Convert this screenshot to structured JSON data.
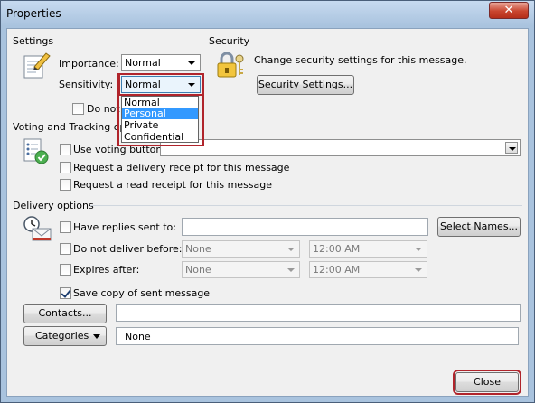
{
  "window": {
    "title": "Properties",
    "close_glyph": "✕"
  },
  "settings": {
    "header": "Settings",
    "importance_label": "Importance:",
    "importance_value": "Normal",
    "sensitivity_label": "Sensitivity:",
    "sensitivity_value": "Normal",
    "do_not_autoarchive_label": "Do not Aut",
    "sensitivity_options": [
      "Normal",
      "Personal",
      "Private",
      "Confidential"
    ],
    "sensitivity_highlighted": "Personal"
  },
  "security": {
    "header": "Security",
    "description": "Change security settings for this message.",
    "button_label": "Security Settings..."
  },
  "voting": {
    "header": "Voting and Tracking optio",
    "use_voting_label": "Use voting buttons:",
    "use_voting_checked": false,
    "delivery_receipt_label": "Request a delivery receipt for this message",
    "delivery_receipt_checked": false,
    "read_receipt_label": "Request a read receipt for this message",
    "read_receipt_checked": false
  },
  "delivery": {
    "header": "Delivery options",
    "replies_label": "Have replies sent to:",
    "replies_checked": false,
    "select_names_label": "Select Names...",
    "not_before_label": "Do not deliver before:",
    "not_before_checked": false,
    "not_before_date": "None",
    "not_before_time": "12:00 AM",
    "expires_label": "Expires after:",
    "expires_checked": false,
    "expires_date": "None",
    "expires_time": "12:00 AM",
    "save_copy_label": "Save copy of sent message",
    "save_copy_checked": true
  },
  "contacts": {
    "button_label": "Contacts..."
  },
  "categories": {
    "button_label": "Categories",
    "value": "None"
  },
  "footer": {
    "close_label": "Close"
  },
  "icons": {
    "settings": "notepad-pencil-icon",
    "security": "lock-keys-icon",
    "voting": "checklist-icon",
    "delivery": "clock-envelope-icon"
  },
  "colors": {
    "highlight_outline": "#b0242b",
    "selected_item": "#3399ff",
    "titlebar": "#a9c3de"
  }
}
